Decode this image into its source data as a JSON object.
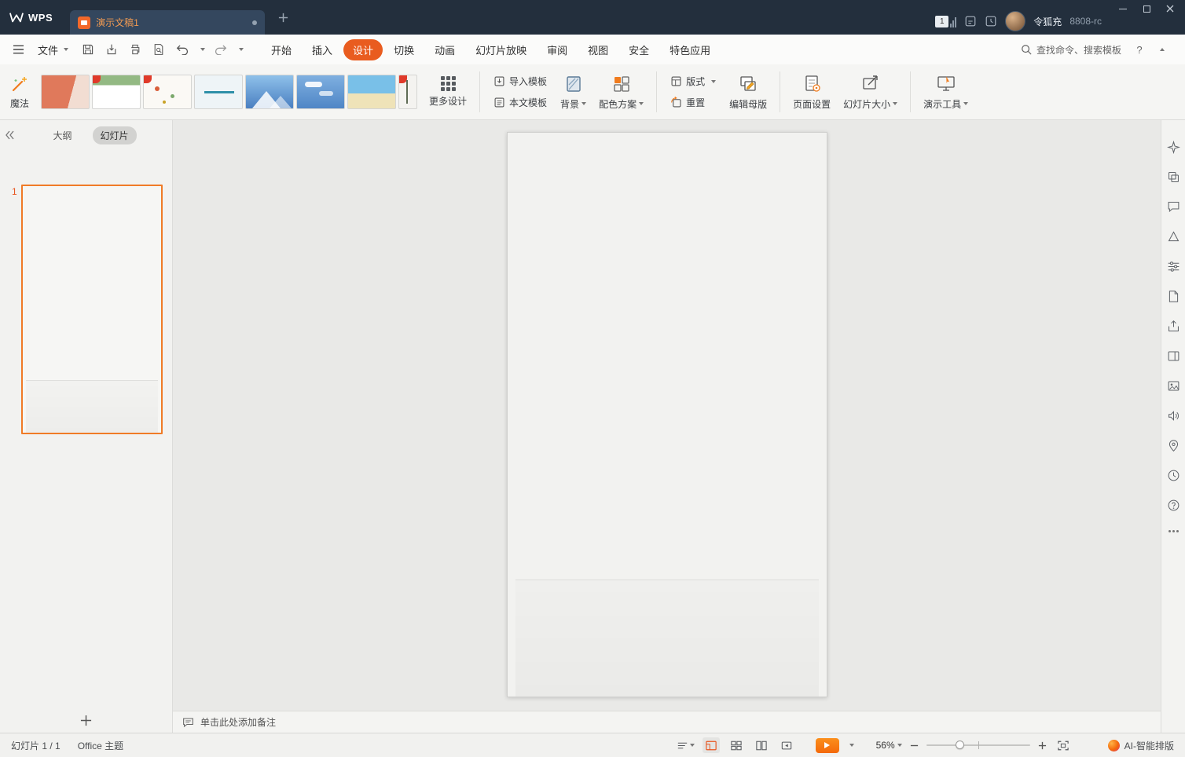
{
  "titlebar": {
    "app_name": "WPS",
    "doc_title": "演示文稿1",
    "badge_count": "1",
    "user_name": "令狐充",
    "build": "8808-rc"
  },
  "menubar": {
    "file_label": "文件",
    "tabs": [
      {
        "label": "开始"
      },
      {
        "label": "插入"
      },
      {
        "label": "设计"
      },
      {
        "label": "切换"
      },
      {
        "label": "动画"
      },
      {
        "label": "幻灯片放映"
      },
      {
        "label": "审阅"
      },
      {
        "label": "视图"
      },
      {
        "label": "安全"
      },
      {
        "label": "特色应用"
      }
    ],
    "active_tab": "设计",
    "search_text": "查找命令、搜索模板",
    "help_label": "?"
  },
  "ribbon": {
    "magic_label": "魔法",
    "more_design_label": "更多设计",
    "import_template_label": "导入模板",
    "doc_template_label": "本文模板",
    "background_label": "背景",
    "color_scheme_label": "配色方案",
    "layout_label": "版式",
    "reset_label": "重置",
    "edit_master_label": "编辑母版",
    "page_setup_label": "页面设置",
    "slide_size_label": "幻灯片大小",
    "present_tools_label": "演示工具",
    "template_names": [
      "orange-report",
      "green-leaf",
      "floral-white",
      "teal-doc",
      "blue-mountain",
      "blue-sky",
      "beach",
      "palm-partial"
    ]
  },
  "sidebar": {
    "outline_tab_label": "大纲",
    "slides_tab_label": "幻灯片",
    "slide_number": "1"
  },
  "notes_bar": {
    "placeholder": "单击此处添加备注"
  },
  "statusbar": {
    "slide_counter": "幻灯片 1 / 1",
    "theme_name": "Office 主题",
    "zoom_percent": "56%",
    "ai_label": "AI-智能排版"
  },
  "colors": {
    "accent_orange": "#e95c1f",
    "titlebar_bg": "#232f3d",
    "play_button_orange": "#f4690a",
    "selection_border": "#f07b27"
  }
}
